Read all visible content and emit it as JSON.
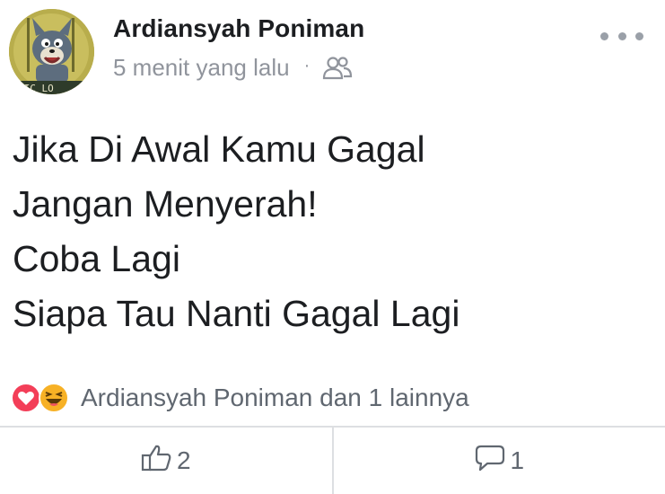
{
  "post": {
    "author": "Ardiansyah Poniman",
    "timestamp": "5 menit yang lalu",
    "separator": "·",
    "audience_icon": "friends-icon",
    "avatar_caption": "XIC LO",
    "lines": [
      "Jika Di Awal Kamu Gagal",
      "Jangan Menyerah!",
      "Coba Lagi",
      "Siapa Tau Nanti Gagal Lagi"
    ]
  },
  "reactions": {
    "icons": [
      "love-reaction-icon",
      "haha-reaction-icon"
    ],
    "summary": "Ardiansyah Poniman dan 1 lainnya"
  },
  "actions": {
    "like_count": "2",
    "comment_count": "1"
  },
  "colors": {
    "text": "#1c1e21",
    "meta": "#90949c",
    "love": "#f33e58",
    "haha": "#f7b125",
    "divider": "#dddfe2"
  }
}
